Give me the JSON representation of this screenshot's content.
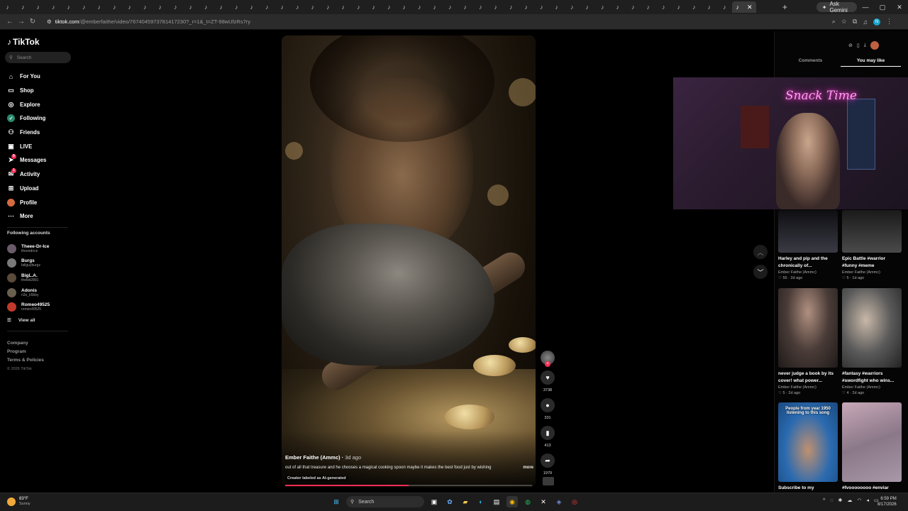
{
  "browser": {
    "tab_glyph": "♪",
    "tab_close": "✕",
    "new_tab": "+",
    "gemini_label": "Ask Gemini",
    "url_host": "tiktok.com",
    "url_path": "/@emberfaithe/video/7674045973781417230?_r=1&_t=ZT-98wUfzRs7ry",
    "profile_letter": "N"
  },
  "sidebar": {
    "logo_text": "TikTok",
    "search_placeholder": "Search",
    "nav": [
      {
        "label": "For You"
      },
      {
        "label": "Shop"
      },
      {
        "label": "Explore"
      },
      {
        "label": "Following"
      },
      {
        "label": "Friends"
      },
      {
        "label": "LIVE"
      },
      {
        "label": "Messages",
        "badge": "9"
      },
      {
        "label": "Activity",
        "badge": "1"
      },
      {
        "label": "Upload"
      },
      {
        "label": "Profile"
      },
      {
        "label": "More"
      }
    ],
    "following_title": "Following accounts",
    "accounts": [
      {
        "name": "Theee-Dr-Ice",
        "handle": "theeedrice"
      },
      {
        "name": "Burgs",
        "handle": "fallguyburgz"
      },
      {
        "name": "BigL.A.",
        "handle": "thekid2891"
      },
      {
        "name": "Adonis",
        "handle": "n3o_k5bby"
      },
      {
        "name": "Romeo49525",
        "handle": "romeo49525"
      }
    ],
    "view_all": "View all",
    "footer": [
      "Company",
      "Program",
      "Terms & Policies"
    ],
    "copyright": "© 2026 TikTok"
  },
  "video": {
    "author": "Ember Faithe (Ammc)",
    "age": "3d ago",
    "caption": "out of all that treasure and he chooses a magical cooking spoon maybe it makes the best food just by wishing",
    "more": "more",
    "ai_label": "Creator labeled as AI-generated",
    "progress": 0.5
  },
  "actions": {
    "likes": "3738",
    "comments": "331",
    "saves": "413",
    "shares": "1979"
  },
  "right_panel": {
    "tab_comments": "Comments",
    "tab_you_may_like": "You may like",
    "stream_sign": "Snack Time",
    "cards": [
      {
        "title": "Harley and pip and the chronically of...",
        "author": "Ember Faithe (Ammc)",
        "likes": "55",
        "age": "2d ago"
      },
      {
        "title": "Epic Battle #warrior #funny #meme",
        "author": "Ember Faithe (Ammc)",
        "likes": "5",
        "age": "1d ago"
      },
      {
        "title": "never judge a book by its cover! what power...",
        "author": "Ember Faithe (Ammc)",
        "likes": "5",
        "age": "2d ago"
      },
      {
        "title": "#fantasy #warriors #swordfight who wins...",
        "author": "Ember Faithe (Ammc)",
        "likes": "4",
        "age": "2d ago"
      },
      {
        "title": "Subscribe to my",
        "author": "",
        "likes": "",
        "age": ""
      },
      {
        "title": "#fvoooooooo #enviar",
        "author": "",
        "likes": "",
        "age": ""
      }
    ],
    "card5_overlay": "People from year 1950 listening to this song"
  },
  "taskbar": {
    "temp": "83°F",
    "condition": "Sunny",
    "search_label": "Search",
    "time": "6:59 PM",
    "date": "8/17/2026"
  }
}
